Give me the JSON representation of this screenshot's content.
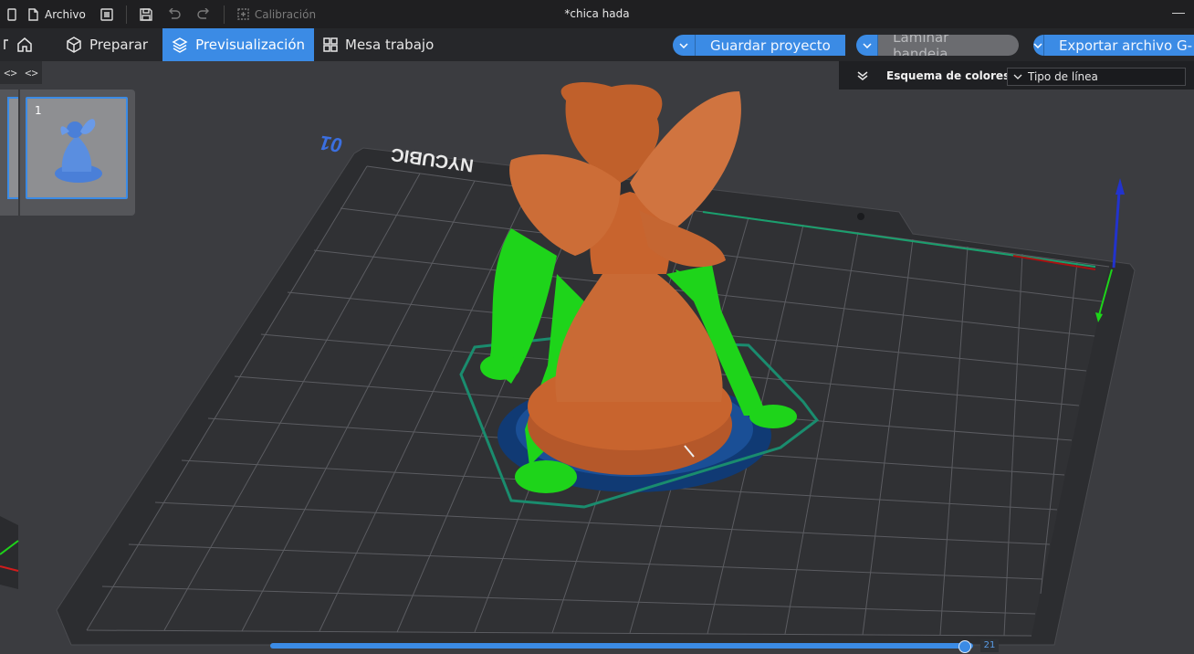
{
  "titlebar": {
    "file_menu": "Archivo",
    "calibration": "Calibración",
    "document_title": "*chica hada"
  },
  "nav": {
    "tabs": [
      {
        "label": "Preparar",
        "active": false
      },
      {
        "label": "Previsualización",
        "active": true
      },
      {
        "label": "Mesa trabajo",
        "active": false
      }
    ]
  },
  "actions": {
    "save_project": "Guardar proyecto",
    "slice_plate": "Laminar bandeja",
    "export": "Exportar archivo G-"
  },
  "plate_list": {
    "plate_number": "1"
  },
  "color_scheme": {
    "label": "Esquema de colores",
    "value": "Tipo de línea"
  },
  "bed": {
    "brand_text": "NYCUBIC",
    "model_text": "01"
  },
  "layer_slider": {
    "value": "21"
  },
  "colors": {
    "accent": "#3b8be5",
    "model_wall": "#c8642e",
    "support": "#1ed41a",
    "skirt": "#1a8c6e",
    "first_layer": "#1a4a8a"
  }
}
